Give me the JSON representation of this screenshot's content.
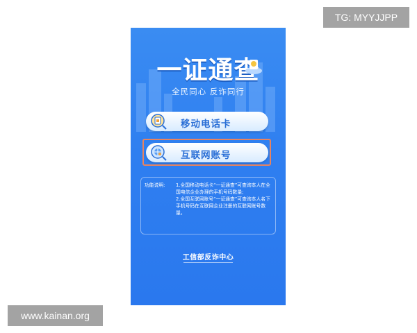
{
  "app": {
    "title": "一证通查",
    "slogan": "全民同心 反诈同行"
  },
  "options": [
    {
      "label": "移动电话卡",
      "icon": "sim-card-search-icon"
    },
    {
      "label": "互联网账号",
      "icon": "internet-globe-search-icon"
    }
  ],
  "description": {
    "heading": "功能说明:",
    "item1": "1.全国移动电话卡“一证通查”可查询本人在全国电信企业办理的手机号码数量;",
    "item2": "2.全国互联网账号“一证通查”可查询本人名下手机号码在互联网企业注册的互联网账号数量。"
  },
  "footer": {
    "text": "工信部反诈中心"
  },
  "watermarks": {
    "top_right": "TG: MYYJJPP",
    "bottom_left": "www.kainan.org"
  },
  "colors": {
    "background": "#2f7ff0",
    "pill_text": "#2a6fd6",
    "highlight": "#e8835f"
  }
}
